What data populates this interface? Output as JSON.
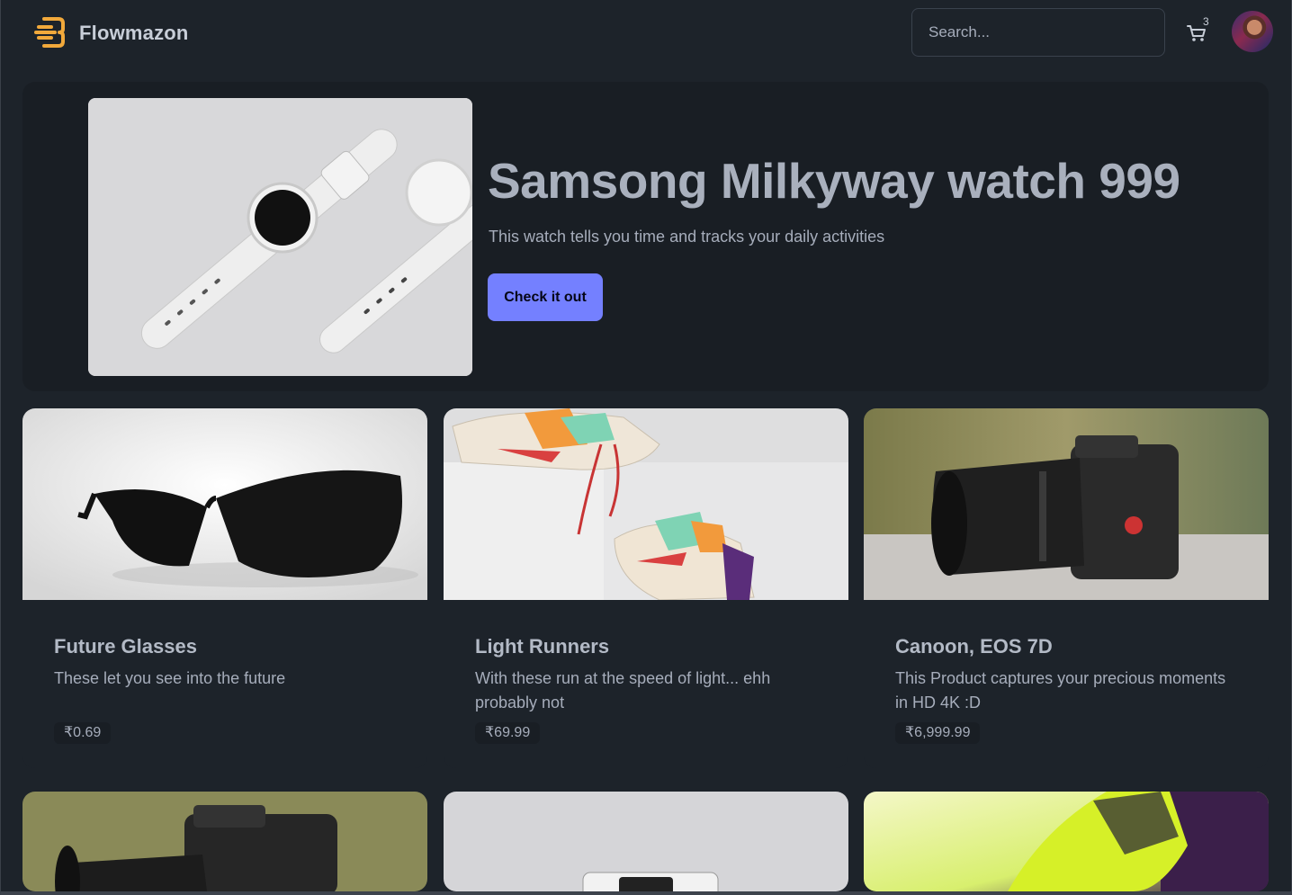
{
  "navbar": {
    "brand": "Flowmazon",
    "search_placeholder": "Search...",
    "cart_count": "3"
  },
  "hero": {
    "title": "Samsong Milkyway watch 999",
    "description": "This watch tells you time and tracks your daily activities",
    "button_label": "Check it out"
  },
  "products": [
    {
      "name": "Future Glasses",
      "description": "These let you see into the future",
      "price": "₹0.69"
    },
    {
      "name": "Light Runners",
      "description": "With these run at the speed of light... ehh probably not",
      "price": "₹69.99"
    },
    {
      "name": "Canoon, EOS 7D",
      "description": "This Product captures your precious moments in HD 4K :D",
      "price": "₹6,999.99"
    }
  ],
  "colors": {
    "background": "#1d232a",
    "hero_background": "#191e24",
    "primary_button": "#7480ff",
    "logo": "#f2a93b"
  }
}
